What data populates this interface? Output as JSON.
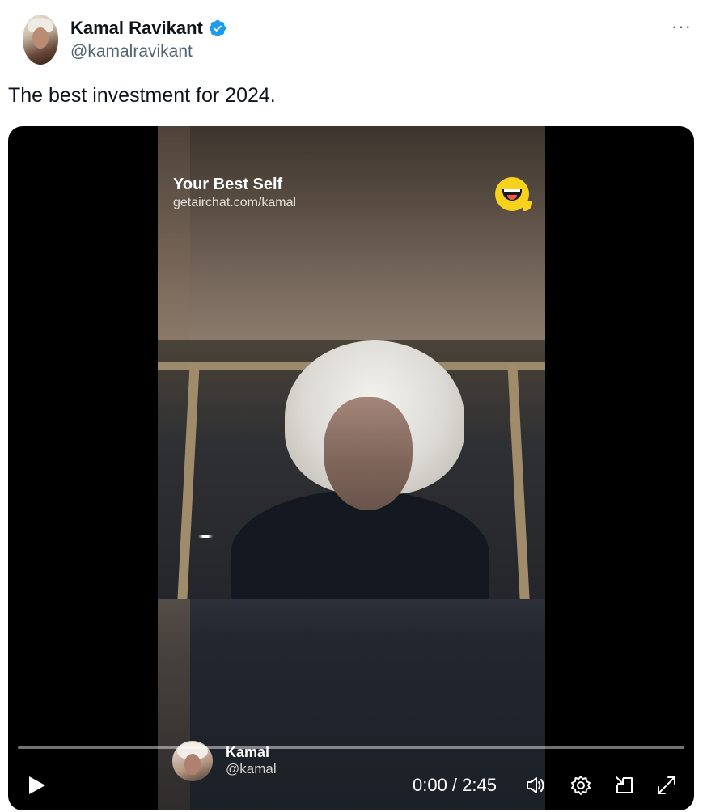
{
  "author": {
    "display_name": "Kamal Ravikant",
    "handle": "@kamalravikant",
    "verified_color": "#1d9bf0"
  },
  "more_label": "···",
  "tweet": {
    "text": "The best investment for 2024."
  },
  "video": {
    "overlay_title": "Your Best Self",
    "overlay_url": "getairchat.com/kamal",
    "speaker_name": "Kamal",
    "speaker_handle": "@kamal",
    "logo": "airchat-logo-icon",
    "progress_fraction": 0.0,
    "current_time": "0:00",
    "duration": "2:45",
    "time_display": "0:00 / 2:45"
  },
  "controls": {
    "play": "play-icon",
    "volume": "volume-icon",
    "settings": "gear-icon",
    "pip": "picture-in-picture-icon",
    "fullscreen": "fullscreen-icon"
  }
}
